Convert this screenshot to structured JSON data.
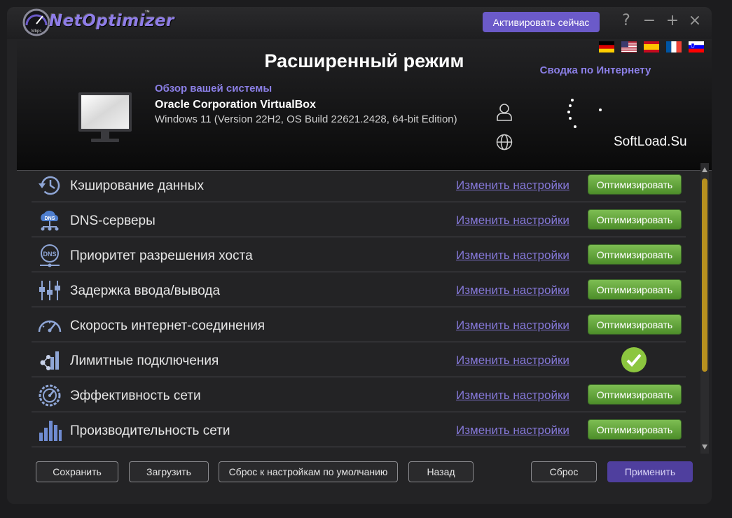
{
  "app": {
    "logo_text": "NetOptimizer",
    "logo_tm": "™",
    "logo_gauge_caption": "Mbps",
    "activate_button": "Активировать сейчас",
    "window_buttons": {
      "help": "?",
      "minimize": "−",
      "maximize": "+",
      "close": "×"
    }
  },
  "languages": [
    "German",
    "English",
    "Spanish",
    "French",
    "Slovenian"
  ],
  "header": {
    "mode_title": "Расширенный режим",
    "internet_summary": "Сводка по Интернету",
    "system_overview_label": "Обзор вашей системы",
    "system_name": "Oracle Corporation VirtualBox",
    "os_info": "Windows 11 (Version 22H2, OS Build 22621.2428, 64-bit Edition)",
    "watermark": "SoftLoad.Su"
  },
  "rows": [
    {
      "icon": "history-clock-icon",
      "label": "Кэширование данных",
      "link": "Изменить настройки",
      "action": "Оптимизировать",
      "optimized": false
    },
    {
      "icon": "dns-cloud-icon",
      "label": "DNS-серверы",
      "link": "Изменить настройки",
      "action": "Оптимизировать",
      "optimized": false
    },
    {
      "icon": "dns-globe-icon",
      "label": "Приоритет разрешения хоста",
      "link": "Изменить настройки",
      "action": "Оптимизировать",
      "optimized": false
    },
    {
      "icon": "sliders-icon",
      "label": "Задержка ввода/вывода",
      "link": "Изменить настройки",
      "action": "Оптимизировать",
      "optimized": false
    },
    {
      "icon": "speedometer-icon",
      "label": "Скорость интернет-соединения",
      "link": "Изменить настройки",
      "action": "Оптимизировать",
      "optimized": false
    },
    {
      "icon": "network-limit-icon",
      "label": "Лимитные подключения",
      "link": "Изменить настройки",
      "action": "",
      "optimized": true
    },
    {
      "icon": "gauge-gear-icon",
      "label": "Эффективность сети",
      "link": "Изменить настройки",
      "action": "Оптимизировать",
      "optimized": false
    },
    {
      "icon": "bar-chart-icon",
      "label": "Производительность сети",
      "link": "Изменить настройки",
      "action": "Оптимизировать",
      "optimized": false
    }
  ],
  "footer": {
    "save": "Сохранить",
    "load": "Загрузить",
    "reset_defaults": "Сброс к настройкам по умолчанию",
    "back": "Назад",
    "reset": "Сброс",
    "apply": "Применить"
  },
  "colors": {
    "accent": "#6b5ac9",
    "link": "#8578d8",
    "optimize_green": "#5fa235",
    "check_green": "#8cc63f"
  }
}
